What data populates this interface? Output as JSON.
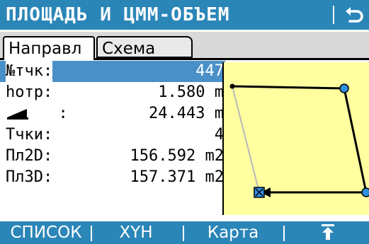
{
  "window": {
    "title": "ПЛОЩАДЬ И ЦММ-ОБЪЕМ",
    "back_icon": "return-icon"
  },
  "tabs": [
    {
      "label": "Направл",
      "active": true
    },
    {
      "label": "Схема",
      "active": false
    }
  ],
  "rows": [
    {
      "label": "№тчк:",
      "value": "447",
      "selected": true
    },
    {
      "label": "hотр:",
      "value": "1.580 m"
    },
    {
      "label": ":",
      "value": "24.443 m",
      "icon": "slope-icon"
    },
    {
      "label": "Тчки:",
      "value": "4"
    },
    {
      "label": "Пл2D:",
      "value": "156.592 m2"
    },
    {
      "label": "Пл3D:",
      "value": "157.371 m2"
    }
  ],
  "schema": {
    "colors": {
      "background": "#ffffa0",
      "point": "#2f8fe0",
      "edge": "#000000",
      "closing_edge": "#b8b8b8"
    }
  },
  "softkeys": [
    {
      "label": "СПИСОК"
    },
    {
      "label": "XYH"
    },
    {
      "label": "Карта"
    },
    {
      "label": "↑",
      "icon": "move-top-icon"
    }
  ]
}
